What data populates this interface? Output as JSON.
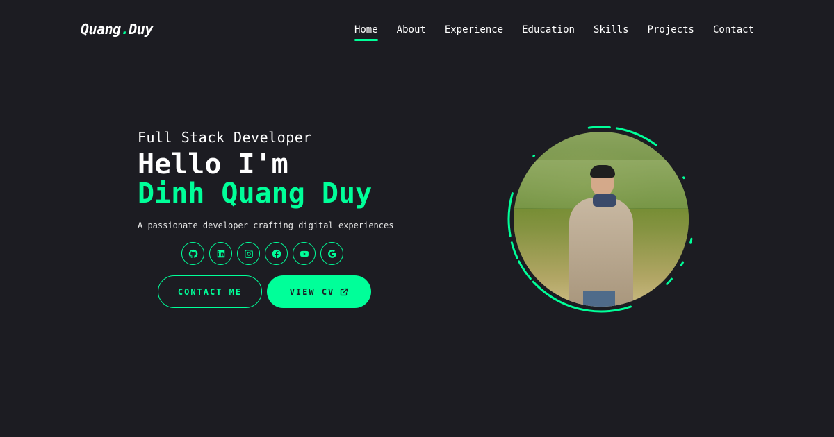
{
  "brand": {
    "logo_first": "Quang",
    "logo_dot": ".",
    "logo_second": "Duy"
  },
  "nav": {
    "items": [
      {
        "label": "Home",
        "active": true
      },
      {
        "label": "About",
        "active": false
      },
      {
        "label": "Experience",
        "active": false
      },
      {
        "label": "Education",
        "active": false
      },
      {
        "label": "Skills",
        "active": false
      },
      {
        "label": "Projects",
        "active": false
      },
      {
        "label": "Contact",
        "active": false
      }
    ]
  },
  "hero": {
    "role": "Full Stack Developer",
    "greeting": "Hello I'm",
    "name": "Dinh Quang Duy",
    "tagline": "A passionate developer crafting digital experiences"
  },
  "socials": [
    {
      "icon": "github-icon"
    },
    {
      "icon": "linkedin-icon"
    },
    {
      "icon": "instagram-icon"
    },
    {
      "icon": "facebook-icon"
    },
    {
      "icon": "youtube-icon"
    },
    {
      "icon": "google-icon"
    }
  ],
  "buttons": {
    "contact_label": "CONTACT ME",
    "cv_label": "VIEW CV",
    "cv_icon": "external-link-icon"
  },
  "colors": {
    "background": "#1c1c22",
    "accent": "#00ff99",
    "text": "#ffffff"
  }
}
